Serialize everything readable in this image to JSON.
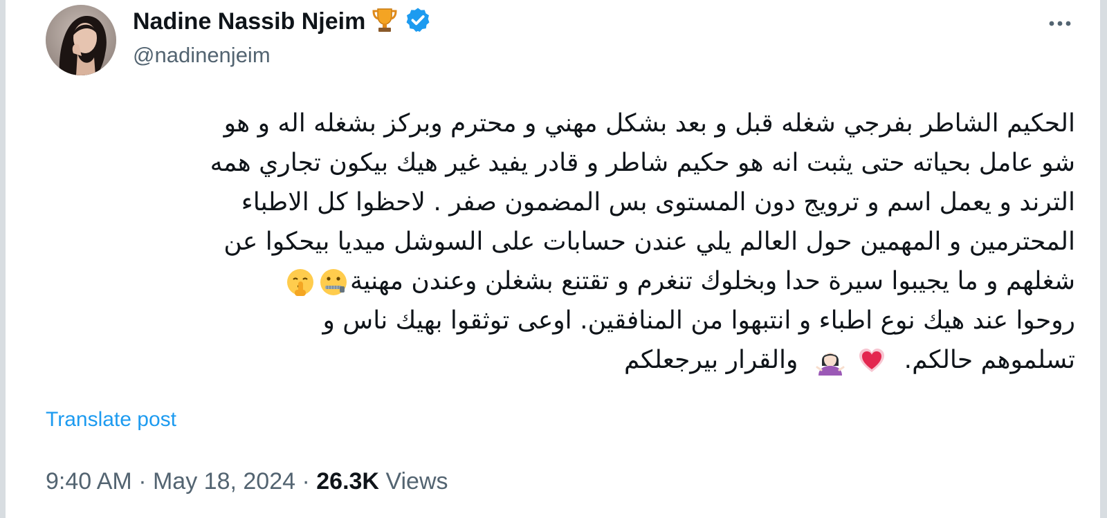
{
  "author": {
    "display_name": "Nadine Nassib Njeim",
    "handle": "@nadinenjeim",
    "badge_icon": "trophy-icon",
    "verified_icon": "verified-badge-icon",
    "verified_color": "#1d9bf0"
  },
  "tweet": {
    "lines": [
      "الحكيم الشاطر بفرجي شغله قبل و بعد بشكل مهني و محترم وبركز بشغله اله و هو",
      "شو عامل بحياته حتى يثبت انه هو حكيم شاطر و قادر يفيد غير هيك بيكون تجاري همه",
      "الترند و يعمل اسم و ترويج دون المستوى بس المضمون صفر . لاحظوا كل الاطباء",
      "المحترمين و المهمين حول العالم يلي عندن حسابات على السوشل ميديا بيحكوا عن",
      "شغلهم و ما يجيبوا سيرة حدا وبخلوك تنغرم و تقتنع بشغلن وعندن مهنية",
      "روحوا عند هيك نوع اطباء و انتبهوا من المنافقين.  اوعى توثقوا بهيك ناس و",
      "تسلموهم حالكم.",
      "والقرار بيرجعلكم"
    ],
    "emojis": [
      "zipper-mouth-face-icon",
      "shushing-face-icon",
      "heart-icon",
      "woman-shrugging-icon"
    ]
  },
  "translate_label": "Translate post",
  "meta": {
    "time": "9:40 AM",
    "separator": "·",
    "date": "May 18, 2024",
    "views_count": "26.3K",
    "views_label": "Views"
  },
  "colors": {
    "text": "#0f1419",
    "secondary": "#536471",
    "link": "#1d9bf0"
  }
}
